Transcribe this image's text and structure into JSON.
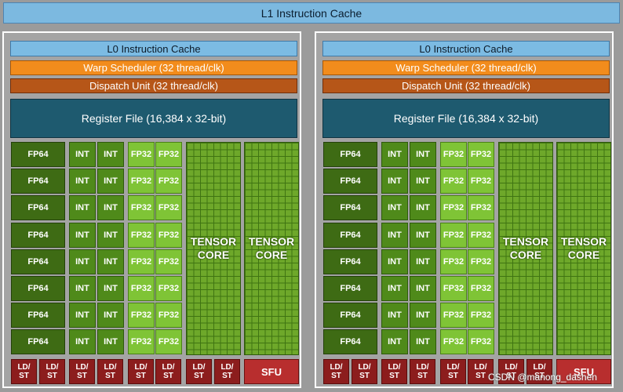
{
  "l1_cache": "L1 Instruction Cache",
  "sm": {
    "l0_cache": "L0 Instruction Cache",
    "warp_scheduler": "Warp Scheduler (32 thread/clk)",
    "dispatch_unit": "Dispatch Unit (32 thread/clk)",
    "register_file": "Register File (16,384 x 32-bit)",
    "fp64_label": "FP64",
    "int_label": "INT",
    "fp32_label": "FP32",
    "tensor_label": "TENSOR\nCORE",
    "ldst_label": "LD/\nST",
    "sfu_label": "SFU"
  },
  "watermark": "CSDN @manong_dashen",
  "colors": {
    "l1": "#7cb9e0",
    "warp_scheduler": "#f28c1c",
    "dispatch_unit": "#b65618",
    "register_file": "#1e5a6f",
    "fp64": "#3e6b14",
    "int": "#4f8a1a",
    "fp32": "#7fc436",
    "tensor": "#6ea82a",
    "ldst": "#8c1d1d",
    "sfu": "#b82e2e"
  }
}
